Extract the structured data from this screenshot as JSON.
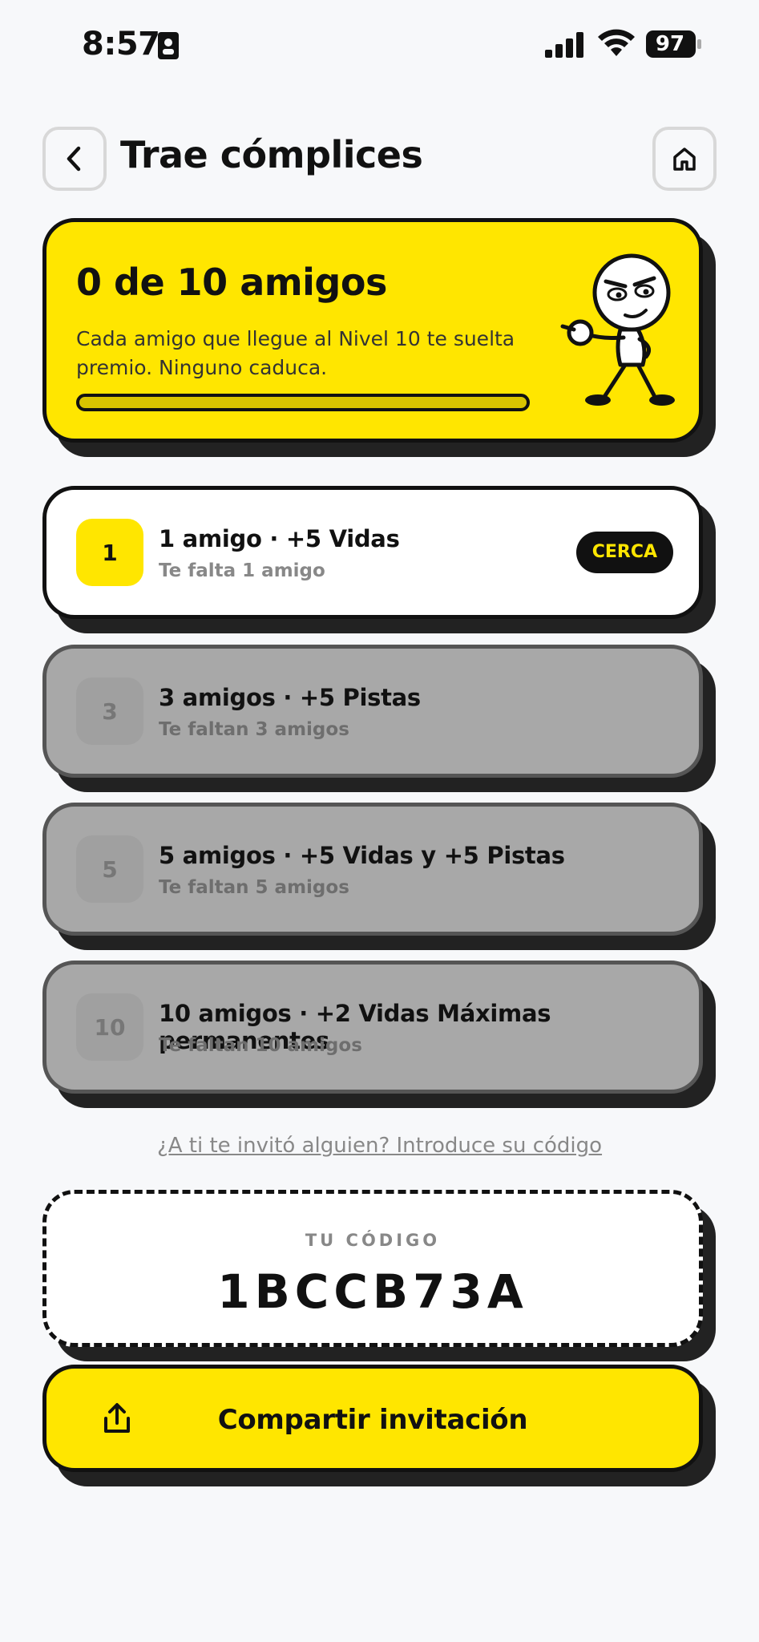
{
  "status_bar": {
    "time": "8:57",
    "battery": "97",
    "icons": [
      "id-card-icon",
      "signal-icon",
      "wifi-icon",
      "battery-icon"
    ]
  },
  "header": {
    "title": "Trae cómplices",
    "back_icon": "chevron-left-icon",
    "home_icon": "home-icon"
  },
  "progress": {
    "title": "0 de 10 amigos",
    "description": "Cada amigo que llegue al Nivel 10 te suelta premio. Ninguno caduca.",
    "fraction": 0
  },
  "milestones": [
    {
      "number": "1",
      "title": "1 amigo · +5 Vidas",
      "subtitle": "Te falta 1 amigo",
      "badge": "CERCA",
      "state": "active"
    },
    {
      "number": "3",
      "title": "3 amigos · +5 Pistas",
      "subtitle": "Te faltan 3 amigos",
      "state": "locked"
    },
    {
      "number": "5",
      "title": "5 amigos · +5 Vidas y +5 Pistas",
      "subtitle": "Te faltan 5 amigos",
      "state": "locked"
    },
    {
      "number": "10",
      "title": "10 amigos · +2 Vidas Máximas permanentes",
      "subtitle": "Te faltan 10 amigos",
      "state": "locked"
    }
  ],
  "invite_link": "¿A ti te invitó alguien? Introduce su código",
  "code": {
    "label": "TU CÓDIGO",
    "value": "1BCCB73A"
  },
  "share": {
    "label": "Compartir invitación",
    "icon": "share-icon"
  },
  "colors": {
    "accent": "#ffe600",
    "ink": "#111111",
    "locked": "#a8a8a8",
    "background": "#f7f8fa"
  }
}
